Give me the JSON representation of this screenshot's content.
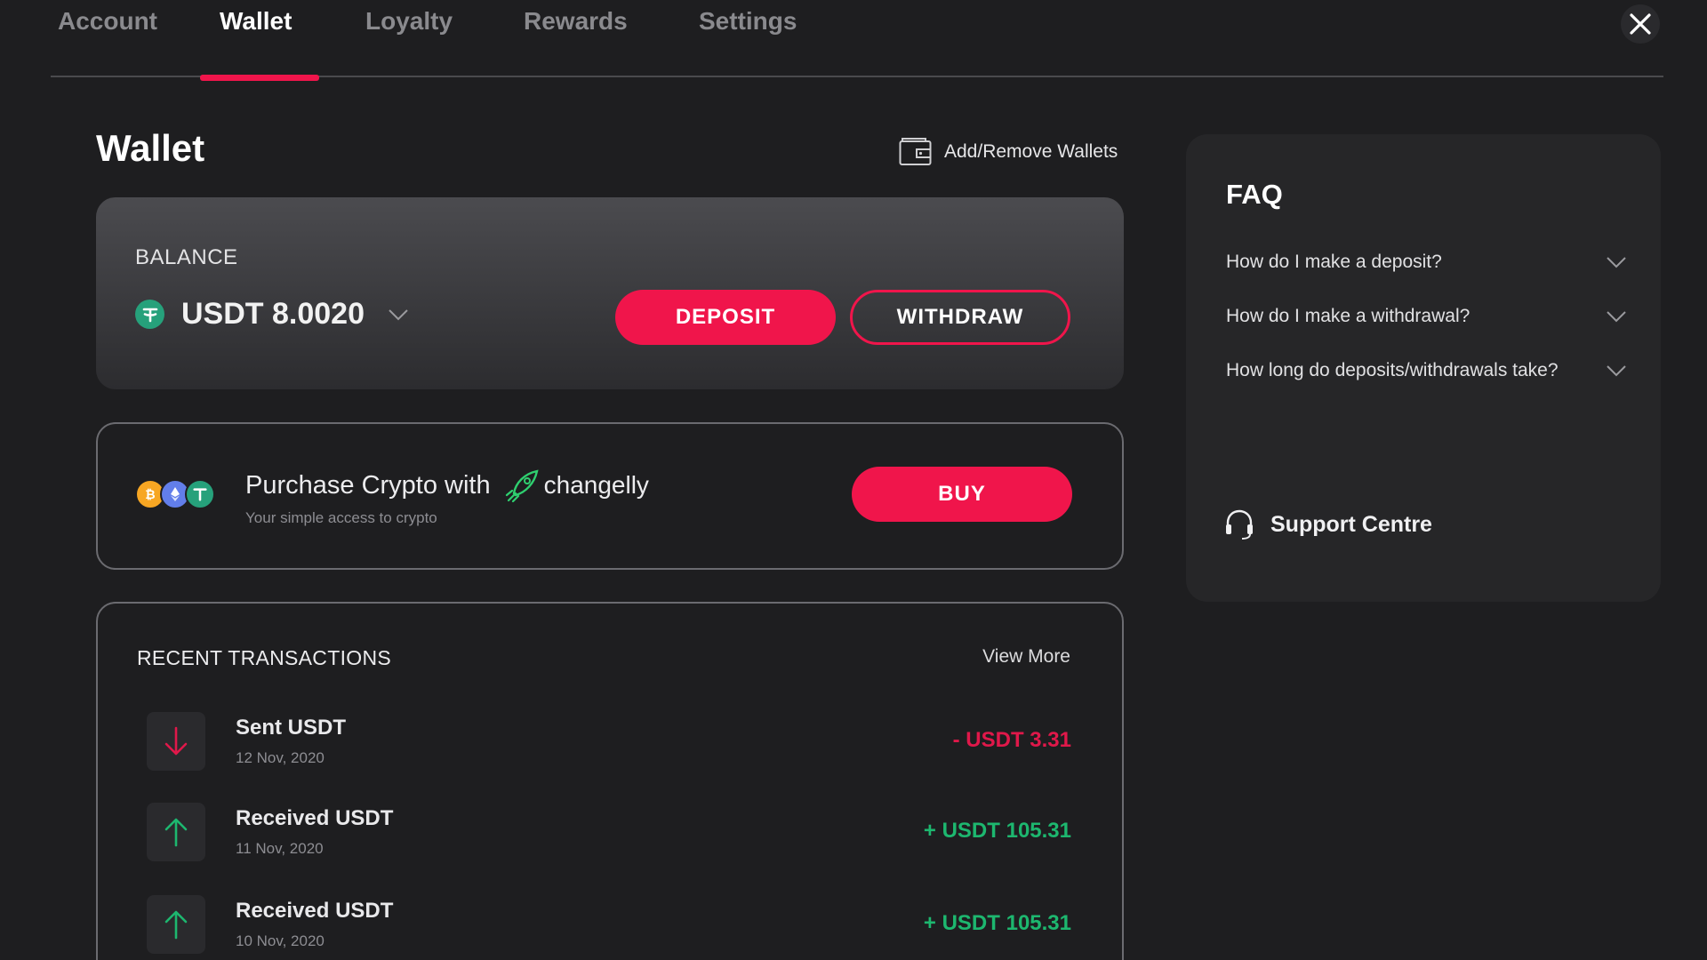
{
  "tabs": [
    {
      "label": "Account"
    },
    {
      "label": "Wallet",
      "active": true
    },
    {
      "label": "Loyalty"
    },
    {
      "label": "Rewards"
    },
    {
      "label": "Settings"
    }
  ],
  "wallet": {
    "title": "Wallet",
    "add_remove_label": "Add/Remove Wallets"
  },
  "balance": {
    "label": "BALANCE",
    "amount": "USDT 8.0020",
    "coin_icon": "tether-icon",
    "deposit_label": "DEPOSIT",
    "withdraw_label": "WITHDRAW"
  },
  "purchase": {
    "title": "Purchase Crypto with",
    "brand": "changelly",
    "subtitle": "Your simple access to crypto",
    "buy_label": "BUY",
    "coins": [
      "bitcoin-icon",
      "ethereum-icon",
      "tether-icon"
    ]
  },
  "transactions": {
    "title": "RECENT TRANSACTIONS",
    "view_more": "View More",
    "items": [
      {
        "name": "Sent USDT",
        "date": "12 Nov, 2020",
        "amount": "- USDT 3.31",
        "direction": "out"
      },
      {
        "name": "Received USDT",
        "date": "11 Nov, 2020",
        "amount": "+ USDT 105.31",
        "direction": "in"
      },
      {
        "name": "Received USDT",
        "date": "10 Nov, 2020",
        "amount": "+ USDT 105.31",
        "direction": "in"
      }
    ]
  },
  "faq": {
    "title": "FAQ",
    "items": [
      {
        "question": "How do I make a deposit?"
      },
      {
        "question": "How do I make a withdrawal?"
      },
      {
        "question": "How long do deposits/withdrawals take?"
      }
    ],
    "support_label": "Support Centre"
  },
  "colors": {
    "accent": "#f0154b",
    "positive": "#1db76f",
    "negative": "#e0184a",
    "tether": "#26a17b",
    "bitcoin": "#f7a623",
    "ethereum": "#627eea"
  }
}
